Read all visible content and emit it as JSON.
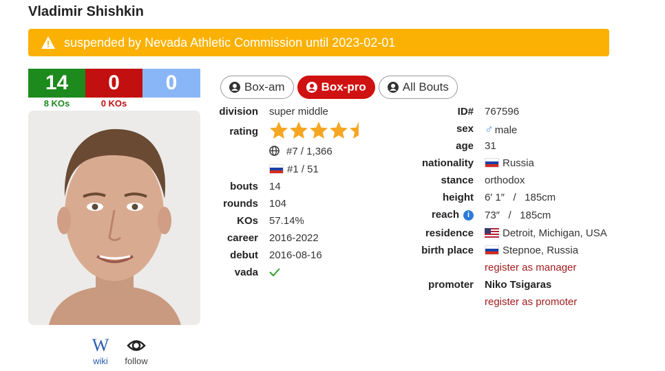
{
  "boxer": {
    "name": "Vladimir Shishkin"
  },
  "banner": {
    "text": "suspended by Nevada Athletic Commission until 2023-02-01",
    "color": "#fbb103"
  },
  "record": {
    "wins": "14",
    "losses": "0",
    "draws": "0",
    "win_kos": "8 KOs",
    "loss_kos": "0 KOs"
  },
  "links": {
    "wiki": "wiki",
    "follow": "follow"
  },
  "tabs": [
    {
      "label": "Box-am",
      "active": false
    },
    {
      "label": "Box-pro",
      "active": true
    },
    {
      "label": "All Bouts",
      "active": false
    }
  ],
  "left_info": {
    "division": {
      "label": "division",
      "value": "super middle"
    },
    "rating": {
      "label": "rating",
      "stars": 4.5,
      "world_rank": "#7 / 1,366",
      "country_rank": "#1 / 51"
    },
    "bouts": {
      "label": "bouts",
      "value": "14"
    },
    "rounds": {
      "label": "rounds",
      "value": "104"
    },
    "kos": {
      "label": "KOs",
      "value": "57.14%"
    },
    "career": {
      "label": "career",
      "value": "2016-2022"
    },
    "debut": {
      "label": "debut",
      "value": "2016-08-16"
    },
    "vada": {
      "label": "vada",
      "value": "check-icon"
    }
  },
  "right_info": {
    "id": {
      "label": "ID#",
      "value": "767596"
    },
    "sex": {
      "label": "sex",
      "value": "male"
    },
    "age": {
      "label": "age",
      "value": "31"
    },
    "nationality": {
      "label": "nationality",
      "value": "Russia"
    },
    "stance": {
      "label": "stance",
      "value": "orthodox"
    },
    "height": {
      "label": "height",
      "value": "6′ 1″   /   185cm"
    },
    "reach": {
      "label": "reach",
      "value": "73″   /   185cm"
    },
    "residence": {
      "label": "residence",
      "value": "Detroit, Michigan, USA"
    },
    "birth_place": {
      "label": "birth place",
      "value": "Stepnoe, Russia"
    },
    "register_manager": "register as manager",
    "promoter": {
      "label": "promoter",
      "value": "Niko Tsigaras"
    },
    "register_promoter": "register as promoter"
  },
  "colors": {
    "win": "#1d8a1d",
    "loss": "#c20f0f",
    "draw": "#89b6f6",
    "active_tab": "#cf1111",
    "star": "#f5a623",
    "link": "#a11c1c"
  }
}
